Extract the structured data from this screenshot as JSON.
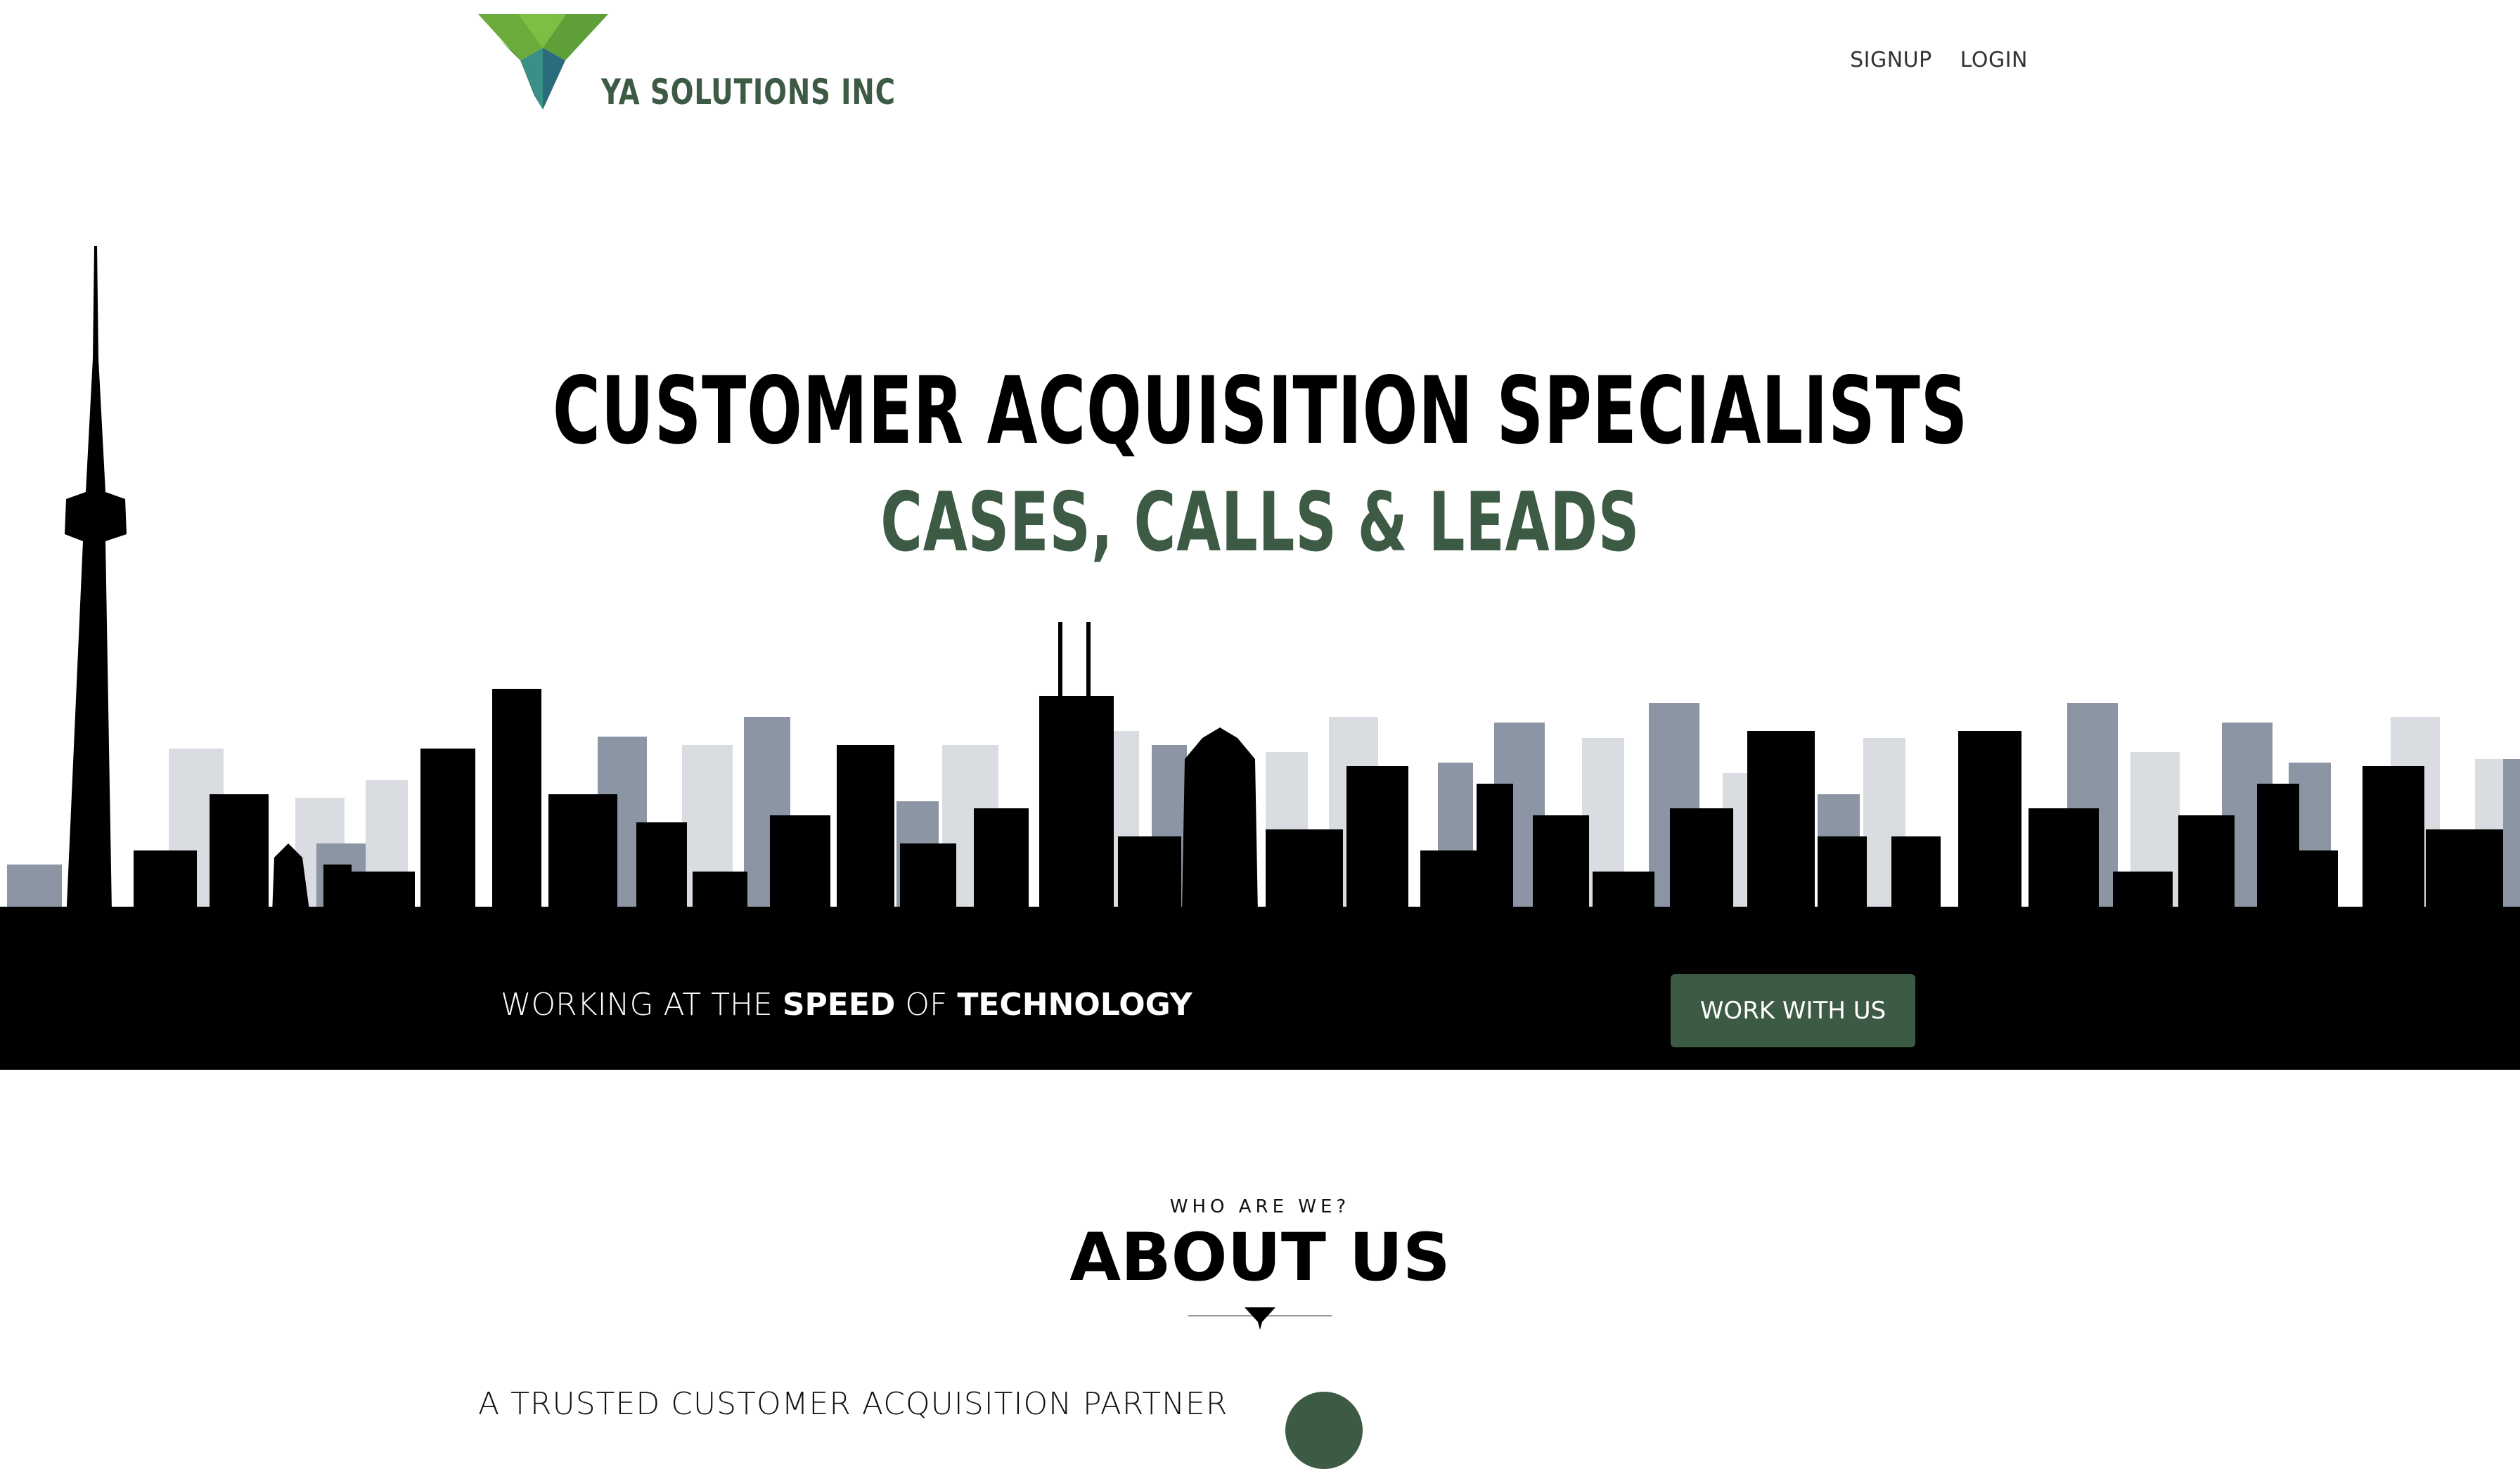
{
  "header": {
    "brand_name": "YA SOLUTIONS INC",
    "logo_icon": "ya-chevron-logo-icon",
    "nav": [
      {
        "label": "SIGNUP"
      },
      {
        "label": "LOGIN"
      }
    ]
  },
  "hero": {
    "title": "CUSTOMER ACQUISITION SPECIALISTS",
    "subtitle": "CASES, CALLS & LEADS",
    "background": "city-skyline-silhouette"
  },
  "band": {
    "tagline": {
      "part1": "WORKING AT THE ",
      "bold1": "SPEED",
      "part2": " OF ",
      "bold2": "TECHNOLOGY"
    },
    "cta_label": "WORK WITH US"
  },
  "about": {
    "kicker": "WHO ARE WE?",
    "title": "ABOUT US",
    "divider_icon": "ya-chevron-divider-icon",
    "lead": "A TRUSTED CUSTOMER ACQUISITION PARTNER"
  },
  "colors": {
    "brand_green": "#3d5a44",
    "logo_light_green": "#7bc043",
    "logo_teal": "#2e8b8b",
    "band_black": "#000000",
    "skyline_far": "#d9dde2",
    "skyline_mid": "#8b95a3"
  }
}
